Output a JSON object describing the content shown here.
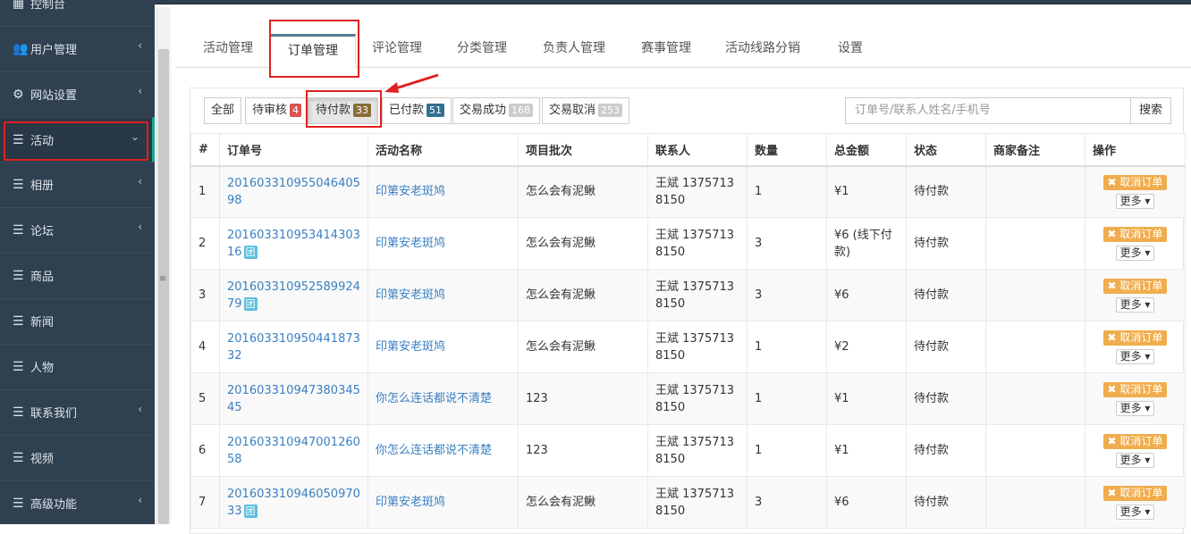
{
  "sidebar": {
    "items": [
      {
        "label": "控制台",
        "icon": "dashboard-icon",
        "has_submenu": false
      },
      {
        "label": "用户管理",
        "icon": "users-icon",
        "has_submenu": true
      },
      {
        "label": "网站设置",
        "icon": "gears-icon",
        "has_submenu": true
      },
      {
        "label": "活动",
        "icon": "bars-icon",
        "has_submenu": true,
        "active": true
      },
      {
        "label": "相册",
        "icon": "bars-icon",
        "has_submenu": true
      },
      {
        "label": "论坛",
        "icon": "bars-icon",
        "has_submenu": true
      },
      {
        "label": "商品",
        "icon": "bars-icon",
        "has_submenu": false
      },
      {
        "label": "新闻",
        "icon": "bars-icon",
        "has_submenu": false
      },
      {
        "label": "人物",
        "icon": "bars-icon",
        "has_submenu": false
      },
      {
        "label": "联系我们",
        "icon": "bars-icon",
        "has_submenu": true
      },
      {
        "label": "视频",
        "icon": "bars-icon",
        "has_submenu": false
      },
      {
        "label": "高级功能",
        "icon": "bars-icon",
        "has_submenu": true
      }
    ]
  },
  "tabs": [
    "活动管理",
    "订单管理",
    "评论管理",
    "分类管理",
    "负责人管理",
    "赛事管理",
    "活动线路分销",
    "设置"
  ],
  "active_tab": "订单管理",
  "filters": [
    {
      "label": "全部",
      "count": "",
      "color": ""
    },
    {
      "label": "待审核",
      "count": "4",
      "color": "#d9534f"
    },
    {
      "label": "待付款",
      "count": "33",
      "color": "#8a6d3b"
    },
    {
      "label": "已付款",
      "count": "51",
      "color": "#31708f"
    },
    {
      "label": "交易成功",
      "count": "168",
      "color": "#cccccc"
    },
    {
      "label": "交易取消",
      "count": "253",
      "color": "#cccccc"
    }
  ],
  "active_filter": "待付款",
  "search": {
    "placeholder": "订单号/联系人姓名/手机号",
    "button": "搜索"
  },
  "table": {
    "headers": [
      "#",
      "订单号",
      "活动名称",
      "项目批次",
      "联系人",
      "数量",
      "总金额",
      "状态",
      "商家备注",
      "操作"
    ],
    "tuan_label": "团",
    "cancel_label": "取消订单",
    "more_label": "更多",
    "rows": [
      {
        "no": "1",
        "order": "20160331095504640598",
        "tuan": false,
        "activity": "印第安老斑鸠",
        "batch": "怎么会有泥鳅",
        "contact": "王斌 13757138150",
        "qty": "1",
        "total": "¥1",
        "status": "待付款",
        "remark": ""
      },
      {
        "no": "2",
        "order": "20160331095341430316",
        "tuan": true,
        "activity": "印第安老斑鸠",
        "batch": "怎么会有泥鳅",
        "contact": "王斌 13757138150",
        "qty": "3",
        "total": "¥6 (线下付款)",
        "status": "待付款",
        "remark": ""
      },
      {
        "no": "3",
        "order": "20160331095258992479",
        "tuan": true,
        "activity": "印第安老斑鸠",
        "batch": "怎么会有泥鳅",
        "contact": "王斌 13757138150",
        "qty": "3",
        "total": "¥6",
        "status": "待付款",
        "remark": ""
      },
      {
        "no": "4",
        "order": "20160331095044187332",
        "tuan": false,
        "activity": "印第安老斑鸠",
        "batch": "怎么会有泥鳅",
        "contact": "王斌 13757138150",
        "qty": "1",
        "total": "¥2",
        "status": "待付款",
        "remark": ""
      },
      {
        "no": "5",
        "order": "20160331094738034545",
        "tuan": false,
        "activity": "你怎么连话都说不清楚",
        "batch": "123",
        "contact": "王斌 13757138150",
        "qty": "1",
        "total": "¥1",
        "status": "待付款",
        "remark": ""
      },
      {
        "no": "6",
        "order": "20160331094700126058",
        "tuan": false,
        "activity": "你怎么连话都说不清楚",
        "batch": "123",
        "contact": "王斌 13757138150",
        "qty": "1",
        "total": "¥1",
        "status": "待付款",
        "remark": ""
      },
      {
        "no": "7",
        "order": "20160331094605097033",
        "tuan": true,
        "activity": "印第安老斑鸠",
        "batch": "怎么会有泥鳅",
        "contact": "王斌 13757138150",
        "qty": "3",
        "total": "¥6",
        "status": "待付款",
        "remark": ""
      }
    ]
  }
}
